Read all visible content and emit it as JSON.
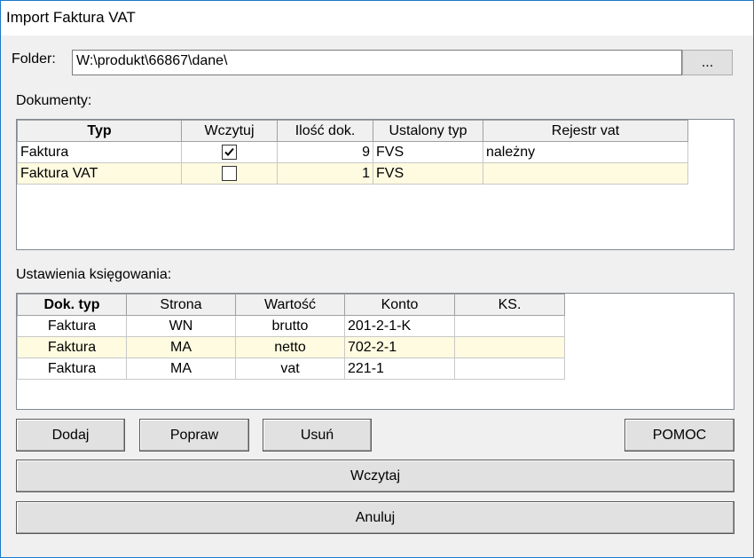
{
  "window": {
    "title": "Import Faktura VAT"
  },
  "folder": {
    "label": "Folder:",
    "value": "W:\\produkt\\66867\\dane\\",
    "browse_label": "..."
  },
  "documents": {
    "label": "Dokumenty:",
    "columns": [
      "Typ",
      "Wczytuj",
      "Ilość dok.",
      "Ustalony typ",
      "Rejestr vat"
    ],
    "rows": [
      {
        "typ": "Faktura",
        "wczytuj": true,
        "ilosc": "9",
        "ustalony": "FVS",
        "rejestr": "należny"
      },
      {
        "typ": "Faktura VAT",
        "wczytuj": false,
        "ilosc": "1",
        "ustalony": "FVS",
        "rejestr": ""
      }
    ]
  },
  "settings": {
    "label": "Ustawienia księgowania:",
    "columns": [
      "Dok. typ",
      "Strona",
      "Wartość",
      "Konto",
      "KS."
    ],
    "rows": [
      {
        "dok_typ": "Faktura",
        "strona": "WN",
        "wartosc": "brutto",
        "konto": "201-2-1-K",
        "ks": ""
      },
      {
        "dok_typ": "Faktura",
        "strona": "MA",
        "wartosc": "netto",
        "konto": "702-2-1",
        "ks": ""
      },
      {
        "dok_typ": "Faktura",
        "strona": "MA",
        "wartosc": "vat",
        "konto": "221-1",
        "ks": ""
      }
    ]
  },
  "buttons": {
    "add": "Dodaj",
    "edit": "Popraw",
    "delete": "Usuń",
    "help": "POMOC",
    "load": "Wczytaj",
    "cancel": "Anuluj"
  },
  "colors": {
    "highlight_row": "#fffbe0",
    "window_border": "#1979ca"
  }
}
